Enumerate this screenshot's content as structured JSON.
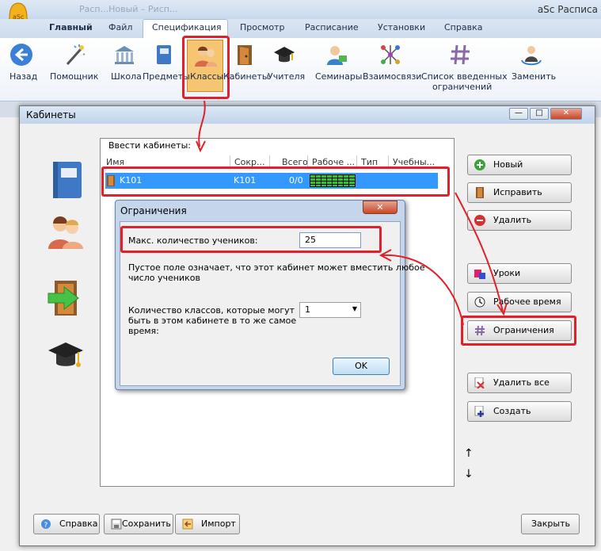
{
  "app": {
    "title": "aSc Расписа",
    "faded_title": "Расп...Новый – Рисп..."
  },
  "menu_tabs": [
    "Главный",
    "Файл",
    "Спецификация",
    "Просмотр",
    "Расписание",
    "Установки",
    "Справка"
  ],
  "ribbon": {
    "back": "Назад",
    "wizard": "Помощник",
    "school": "Школа",
    "subjects": "Предметы",
    "classes": "Классы",
    "rooms": "Кабинеты",
    "teachers": "Учителя",
    "seminars": "Семинары",
    "relations": "Взаимосвязи",
    "constraints_l1": "Список введенных",
    "constraints_l2": "ограничений",
    "replace": "Заменить"
  },
  "window": {
    "title": "Кабинеты",
    "list_label": "Ввести кабинеты:",
    "columns": [
      "Имя",
      "Сокр...",
      "Всего",
      "Рабоче ...",
      "Тип",
      "Учебны..."
    ],
    "rows": [
      {
        "name": "K101",
        "short": "K101",
        "total": "0/0"
      }
    ],
    "buttons": {
      "new": "Новый",
      "edit": "Исправить",
      "delete": "Удалить",
      "lessons": "Уроки",
      "work_time": "Рабочее время",
      "constraints": "Ограничения",
      "delete_all": "Удалить все",
      "create": "Создать",
      "help": "Справка",
      "save": "Сохранить",
      "import": "Импорт",
      "close": "Закрыть"
    }
  },
  "dialog": {
    "title": "Ограничения",
    "max_students_label": "Макс. количество учеников:",
    "max_students_value": "25",
    "note_l1": "Пустое поле означает, что этот кабинет может вместить любое",
    "note_l2": "число учеников",
    "class_count_l1": "Количество классов, которые могут",
    "class_count_l2": "быть в этом кабинете в то же самое",
    "class_count_l3": "время:",
    "class_count_value": "1",
    "ok": "OK"
  },
  "colors": {
    "highlight": "#e0202a",
    "selection": "#3399ff"
  }
}
